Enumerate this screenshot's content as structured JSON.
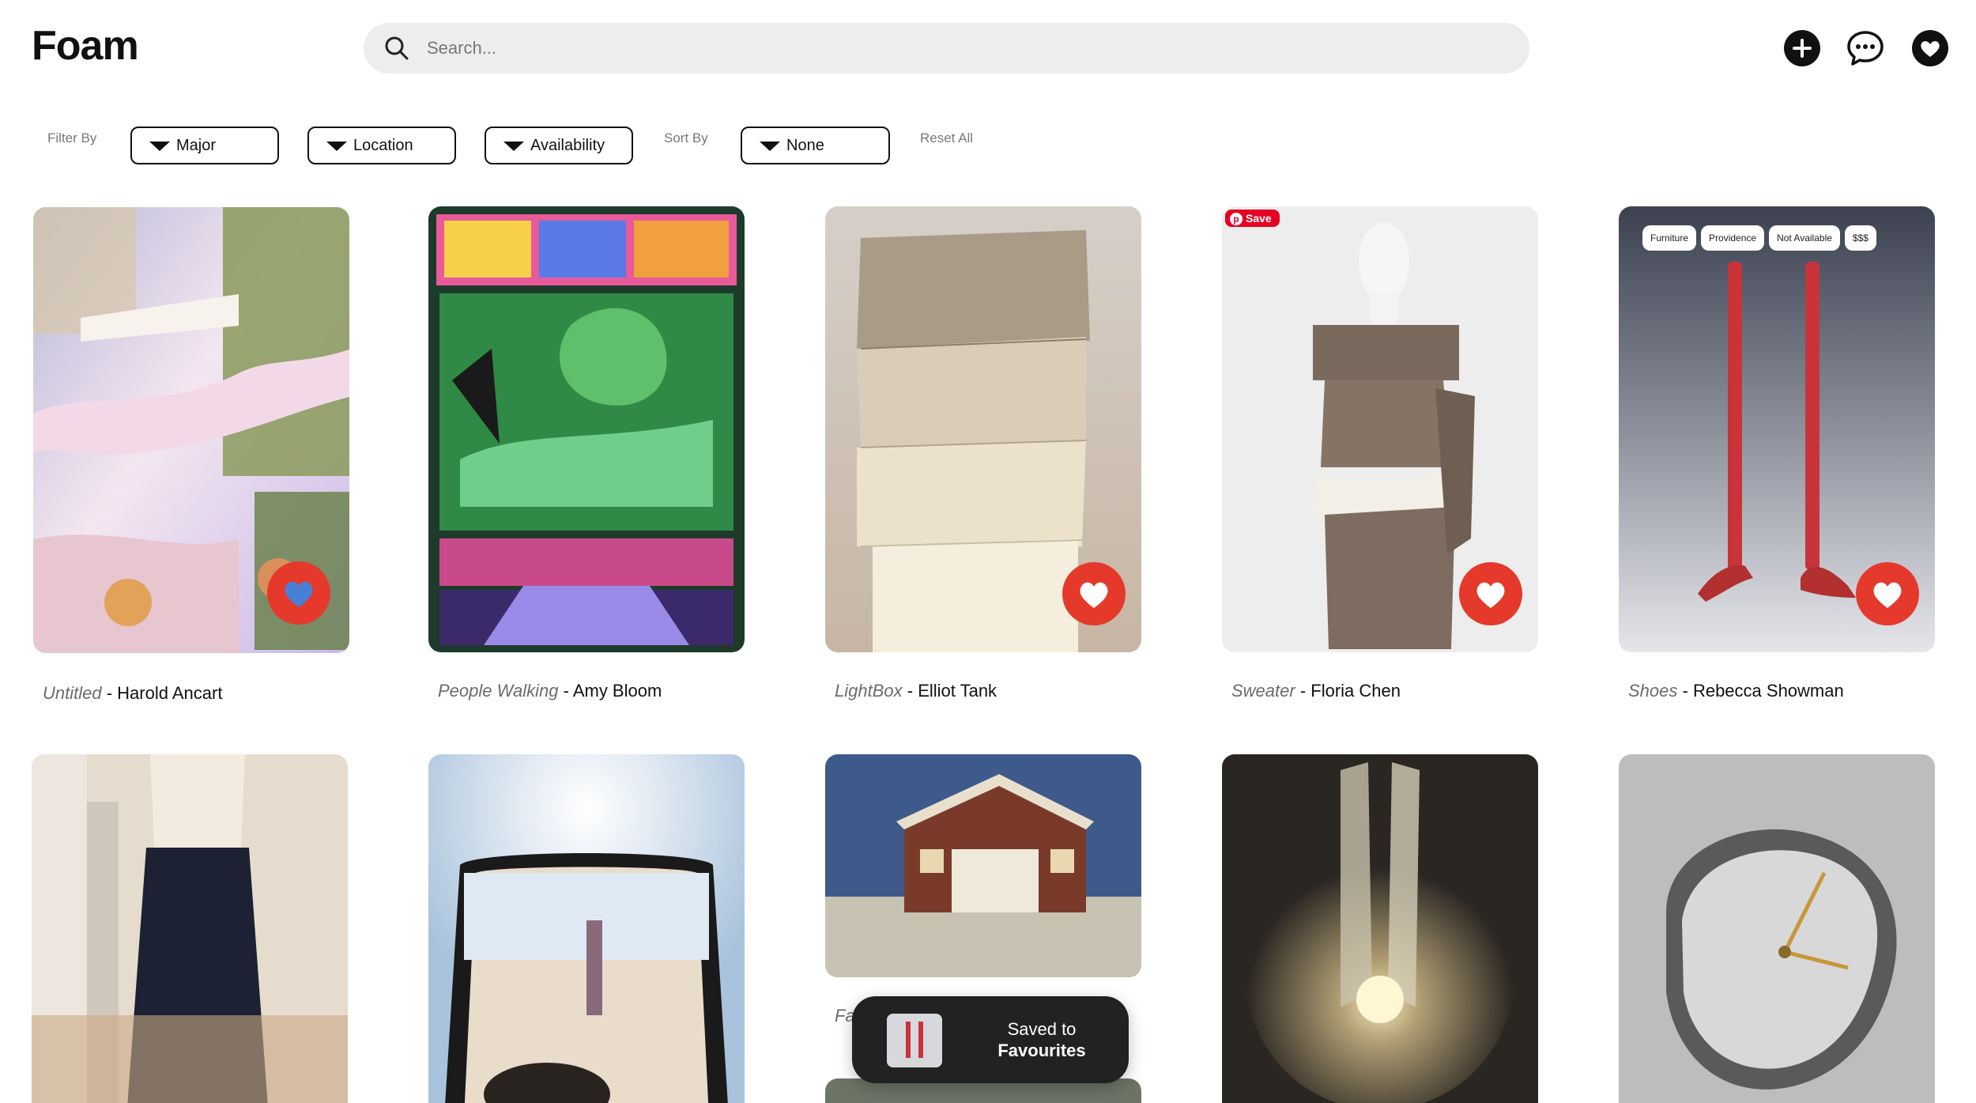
{
  "app": {
    "logo": "Foam"
  },
  "search": {
    "placeholder": "Search..."
  },
  "header_icons": [
    "add-icon",
    "chat-icon",
    "heart-icon"
  ],
  "filters": {
    "filter_by_label": "Filter By",
    "major": "Major",
    "location": "Location",
    "availability": "Availability",
    "sort_by_label": "Sort By",
    "sort_value": "None",
    "reset": "Reset All"
  },
  "cards": [
    {
      "title": "Untitled",
      "artist": "Harold Ancart",
      "favorited": true
    },
    {
      "title": "People Walking",
      "artist": "Amy Bloom",
      "favorited": false
    },
    {
      "title": "LightBox",
      "artist": "Elliot Tank",
      "favorited": true
    },
    {
      "title": "Sweater",
      "artist": "Floria Chen",
      "favorited": true,
      "badge": "Save"
    },
    {
      "title": "Shoes",
      "artist": "Rebecca Showman",
      "favorited": true,
      "tags": [
        "Furniture",
        "Providence",
        "Not Available",
        "$$$"
      ]
    },
    {
      "title": "",
      "artist": ""
    },
    {
      "title": "",
      "artist": ""
    },
    {
      "title": "Fa",
      "artist": ""
    },
    {
      "title": "",
      "artist": ""
    },
    {
      "title": "",
      "artist": ""
    }
  ],
  "separator": " - ",
  "toast": {
    "line1": "Saved to",
    "line2": "Favourites"
  },
  "colors": {
    "accent": "#e5392b",
    "text": "#111111",
    "muted": "#777777",
    "search_bg": "#ededed",
    "toast_bg": "#222222"
  }
}
